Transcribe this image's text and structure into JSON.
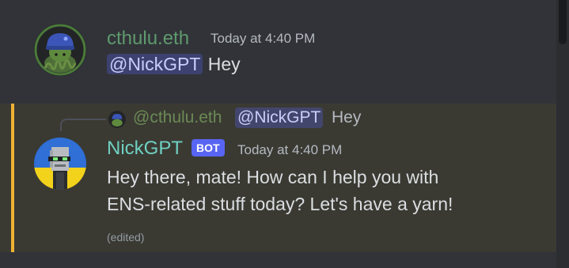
{
  "colors": {
    "background": "#313338",
    "highlight_background": "#3a3a33",
    "highlight_bar": "#f0b232",
    "mention_text": "#c9cdfb",
    "bot_badge": "#5865f2",
    "username_cthulu": "#5f9a6e",
    "username_nickgpt": "#6fd0c2",
    "timestamp": "#b5bac1"
  },
  "messages": [
    {
      "author": "cthulu.eth",
      "timestamp": "Today at 4:40 PM",
      "mention": "@NickGPT",
      "text": "Hey",
      "avatar_icon": "octopus-helmet-avatar-icon"
    },
    {
      "reply": {
        "author": "@cthulu.eth",
        "mention": "@NickGPT",
        "text": "Hey",
        "avatar_icon": "octopus-helmet-avatar-icon"
      },
      "author": "NickGPT",
      "badge": "BOT",
      "timestamp": "Today at 4:40 PM",
      "lines": [
        "Hey there, mate! How can I help you with",
        "ENS-related stuff today? Let's have a yarn!"
      ],
      "edited": "(edited)",
      "avatar_icon": "pixel-robot-avatar-icon"
    }
  ]
}
